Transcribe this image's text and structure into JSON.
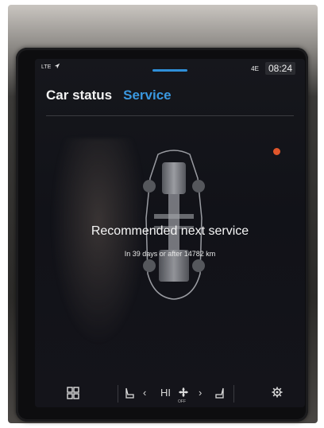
{
  "status_bar": {
    "network": "LTE",
    "right_indicator": "4E",
    "time": "08:24"
  },
  "tabs": [
    {
      "label": "Car status",
      "active": false
    },
    {
      "label": "Service",
      "active": true
    }
  ],
  "service": {
    "headline": "Recommended next service",
    "subline": "In 39 days or after 14782 km"
  },
  "climate": {
    "fan_label": "HI",
    "fan_state": "OFF"
  },
  "icons": {
    "location": "location-arrow-icon",
    "apps": "grid-icon",
    "seat_heat": "seat-heat-icon",
    "fan": "fan-icon",
    "settings": "gear-icon"
  },
  "colors": {
    "accent": "#3a98e0",
    "warning_dot": "#e0562b"
  }
}
